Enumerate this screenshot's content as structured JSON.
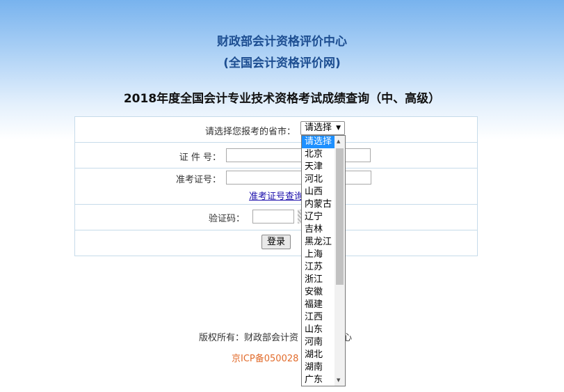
{
  "header": {
    "org_title": "财政部会计资格评价中心",
    "org_subtitle": "(全国会计资格评价网)",
    "page_title": "2018年度全国会计专业技术资格考试成绩查询（中、高级）"
  },
  "form": {
    "province_label": "请选择您报考的省市：",
    "province_value": "请选择",
    "id_label": "证 件 号：",
    "id_value": "",
    "ticket_label": "准考证号：",
    "ticket_value": "",
    "ticket_lookup_link": "准考证号查询",
    "captcha_label": "验证码：",
    "captcha_value": "",
    "login_button": "登录"
  },
  "dropdown": {
    "options": [
      "请选择",
      "北京",
      "天津",
      "河北",
      "山西",
      "内蒙古",
      "辽宁",
      "吉林",
      "黑龙江",
      "上海",
      "江苏",
      "浙江",
      "安徽",
      "福建",
      "江西",
      "山东",
      "河南",
      "湖北",
      "湖南",
      "广东"
    ],
    "selected_index": 0
  },
  "footer": {
    "copyright": "版权所有：财政部会计资",
    "copyright_tail": "心",
    "icp": "京ICP备050028"
  }
}
